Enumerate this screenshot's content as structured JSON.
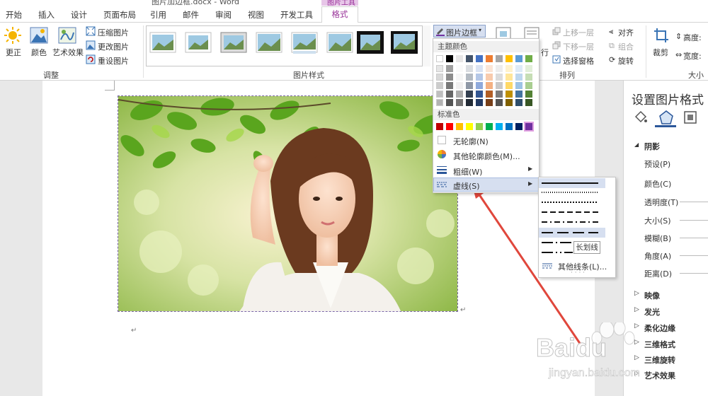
{
  "window": {
    "title": "图片加边框.docx - Word",
    "context_tab_group": "图片工具"
  },
  "tabs": [
    {
      "label": "开始"
    },
    {
      "label": "插入"
    },
    {
      "label": "设计"
    },
    {
      "label": "页面布局"
    },
    {
      "label": "引用"
    },
    {
      "label": "邮件"
    },
    {
      "label": "审阅"
    },
    {
      "label": "视图"
    },
    {
      "label": "开发工具"
    },
    {
      "label": "格式"
    }
  ],
  "ribbon": {
    "adjust": {
      "group_label": "调整",
      "corrections": "更正",
      "color": "颜色",
      "artistic": "艺术效果",
      "compress": "压缩图片",
      "change": "更改图片",
      "reset": "重设图片"
    },
    "styles": {
      "group_label": "图片样式",
      "border_button": "图片边框"
    },
    "position_fragment": "行",
    "arrange": {
      "group_label": "排列",
      "bring_forward": "上移一层",
      "send_backward": "下移一层",
      "selection_pane": "选择窗格",
      "align": "对齐",
      "group": "组合",
      "rotate": "旋转"
    },
    "size": {
      "group_label": "大小",
      "crop": "裁剪",
      "height": "高度:",
      "width": "宽度:"
    }
  },
  "border_menu": {
    "theme_colors_header": "标准色",
    "theme_header": "主题颜色",
    "no_outline": "无轮廓(N)",
    "more_colors": "其他轮廓颜色(M)...",
    "weight": "粗细(W)",
    "dashes": "虚线(S)",
    "theme_colors": [
      "#ffffff",
      "#000000",
      "#e7e6e6",
      "#44546a",
      "#4472c4",
      "#ed7d31",
      "#a5a5a5",
      "#ffc000",
      "#5b9bd5",
      "#70ad47"
    ],
    "standard_colors": [
      "#c00000",
      "#ff0000",
      "#ffc000",
      "#ffff00",
      "#92d050",
      "#00b050",
      "#00b0f0",
      "#0070c0",
      "#002060",
      "#7030a0"
    ]
  },
  "dash_submenu": {
    "more_lines": "其他线条(L)...",
    "tooltip": "长划线"
  },
  "format_panel": {
    "title": "设置图片格式",
    "sections": {
      "shadow": "阴影",
      "reflection": "映像",
      "glow": "发光",
      "soft_edges": "柔化边缘",
      "format_3d": "三维格式",
      "rotation_3d": "三维旋转",
      "art_effect": "艺术效果"
    },
    "shadow_fields": {
      "preset": "预设(P)",
      "color": "颜色(C)",
      "transparency": "透明度(T)",
      "size": "大小(S)",
      "blur": "模糊(B)",
      "angle": "角度(A)",
      "distance": "距离(D)"
    }
  },
  "watermark": {
    "brand": "Baidu",
    "sub": "jingyan.baidu.com"
  },
  "colors": {
    "accent": "#993399",
    "highlight": "#d6dff0"
  }
}
